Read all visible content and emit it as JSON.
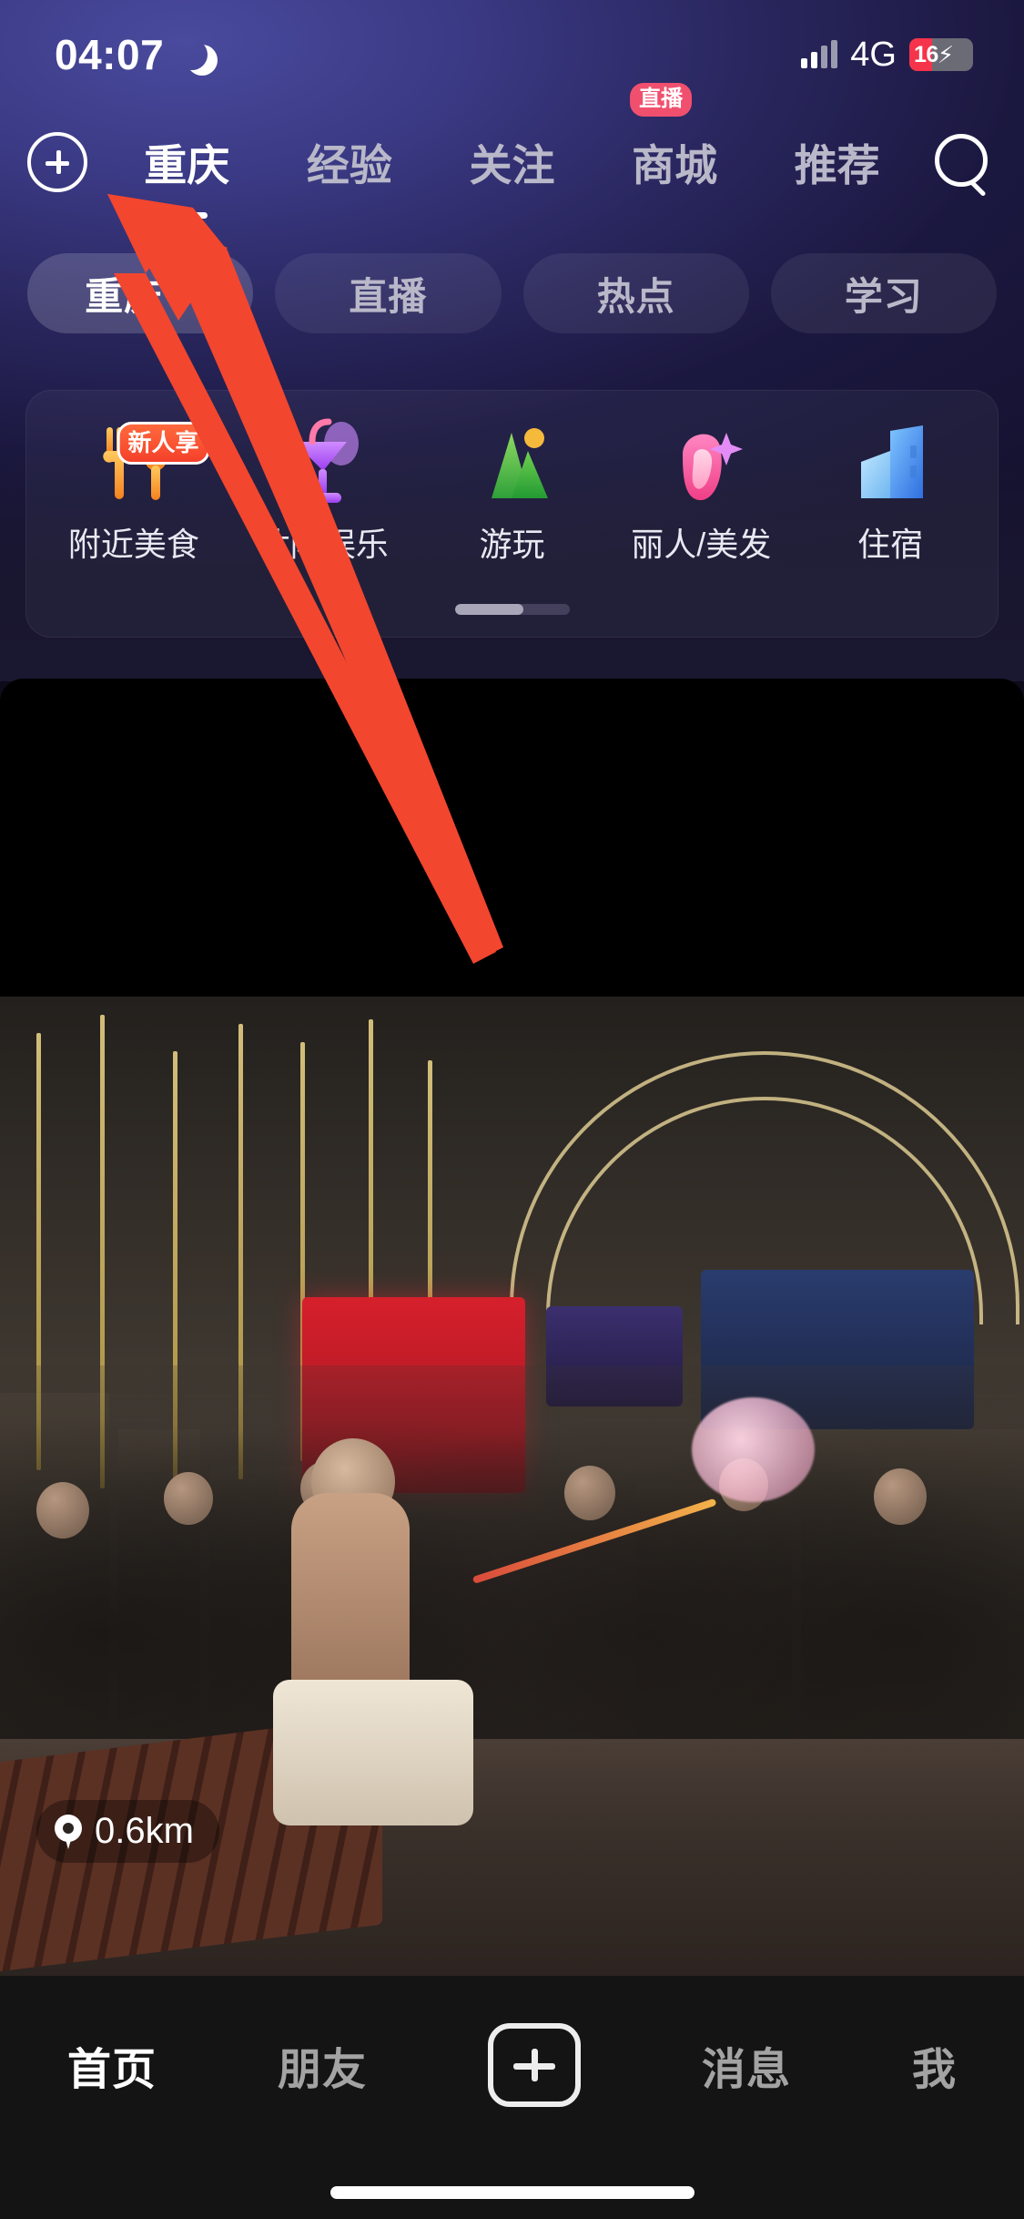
{
  "status_bar": {
    "time": "04:07",
    "moon_icon": "moon-icon",
    "network": "4G",
    "battery_level": "16",
    "charging_icon": "bolt-icon",
    "signal_icon": "signal-bars-icon"
  },
  "top_nav": {
    "add_icon": "plus-circle-icon",
    "search_icon": "search-icon",
    "tabs": [
      {
        "label": "重庆",
        "active": true,
        "badge": ""
      },
      {
        "label": "经验",
        "active": false,
        "badge": ""
      },
      {
        "label": "关注",
        "active": false,
        "badge": ""
      },
      {
        "label": "商城",
        "active": false,
        "badge": "直播"
      },
      {
        "label": "推荐",
        "active": false,
        "badge": ""
      }
    ]
  },
  "chips": [
    {
      "label": "重庆",
      "suffix": "⇆",
      "active": true
    },
    {
      "label": "直播",
      "suffix": "",
      "active": false
    },
    {
      "label": "热点",
      "suffix": "",
      "active": false
    },
    {
      "label": "学习",
      "suffix": "",
      "active": false
    }
  ],
  "categories": {
    "items": [
      {
        "label": "附近美食",
        "icon": "fork-knife-icon",
        "badge": "新人享"
      },
      {
        "label": "休闲娱乐",
        "icon": "cocktail-glass-icon",
        "badge": ""
      },
      {
        "label": "游玩",
        "icon": "mountain-icon",
        "badge": ""
      },
      {
        "label": "丽人/美发",
        "icon": "beauty-face-icon",
        "badge": ""
      },
      {
        "label": "住宿",
        "icon": "buildings-icon",
        "badge": ""
      }
    ],
    "pager_icon": "page-indicator"
  },
  "media": {
    "distance_label": "0.6km",
    "location_icon": "location-pin-icon"
  },
  "bottom_nav": {
    "items": [
      {
        "label": "首页",
        "active": true
      },
      {
        "label": "朋友",
        "active": false
      },
      {
        "label": "消息",
        "active": false
      },
      {
        "label": "我",
        "active": false
      }
    ],
    "post_icon": "plus-square-button",
    "home_indicator": "home-indicator"
  },
  "annotation": {
    "arrow_color": "#f2462f",
    "arrow_icon": "pointer-arrow-annotation"
  },
  "colors": {
    "header_gradient_start": "#3f3e90",
    "header_gradient_end": "#141128",
    "accent_red": "#f0506e",
    "badge_orange": "#f4402a",
    "battery_red": "#f5334a",
    "bottom_bar": "#141414"
  }
}
